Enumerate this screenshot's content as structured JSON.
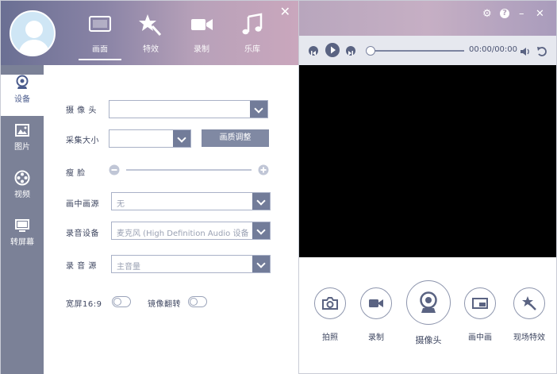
{
  "tabs": [
    {
      "label": "画面",
      "icon": "screen-icon"
    },
    {
      "label": "特效",
      "icon": "magic-wand-icon"
    },
    {
      "label": "录制",
      "icon": "video-camera-icon"
    },
    {
      "label": "乐库",
      "icon": "music-icon"
    }
  ],
  "left_close": "✕",
  "sidebar": [
    {
      "label": "设备",
      "icon": "webcam-icon"
    },
    {
      "label": "图片",
      "icon": "image-icon"
    },
    {
      "label": "视频",
      "icon": "film-reel-icon"
    },
    {
      "label": "转屏幕",
      "icon": "monitor-icon"
    }
  ],
  "settings": {
    "camera_label": "摄 像 头",
    "camera_value": "",
    "capture_size_label": "采集大小",
    "capture_size_value": "",
    "image_adjust_button": "画质调整",
    "face_label": "瘦    脸",
    "face_slider_level": 0,
    "pip_source_label": "画中画源",
    "pip_source_value": "无",
    "audio_device_label": "录音设备",
    "audio_device_value": "麦克风 (High Definition Audio 设备)",
    "audio_source_label": "录 音 源",
    "audio_source_value": "主音量",
    "widescreen_label": "宽屏16:9",
    "widescreen_on": false,
    "mirror_label": "镜像翻转",
    "mirror_on": false
  },
  "window_controls": {
    "settings": "⚙",
    "help": "?",
    "minimize": "–",
    "close": "✕"
  },
  "player": {
    "time": "00:00/00:00",
    "progress": 0
  },
  "actions": [
    {
      "label": "拍照",
      "icon": "camera-icon"
    },
    {
      "label": "录制",
      "icon": "video-camera-icon"
    },
    {
      "label": "摄像头",
      "icon": "webcam-icon"
    },
    {
      "label": "画中画",
      "icon": "picture-in-picture-icon"
    },
    {
      "label": "现场特效",
      "icon": "magic-wand-icon"
    }
  ],
  "colors": {
    "accent": "#727c99",
    "sidebar": "#7b8197",
    "video": "#000000"
  }
}
